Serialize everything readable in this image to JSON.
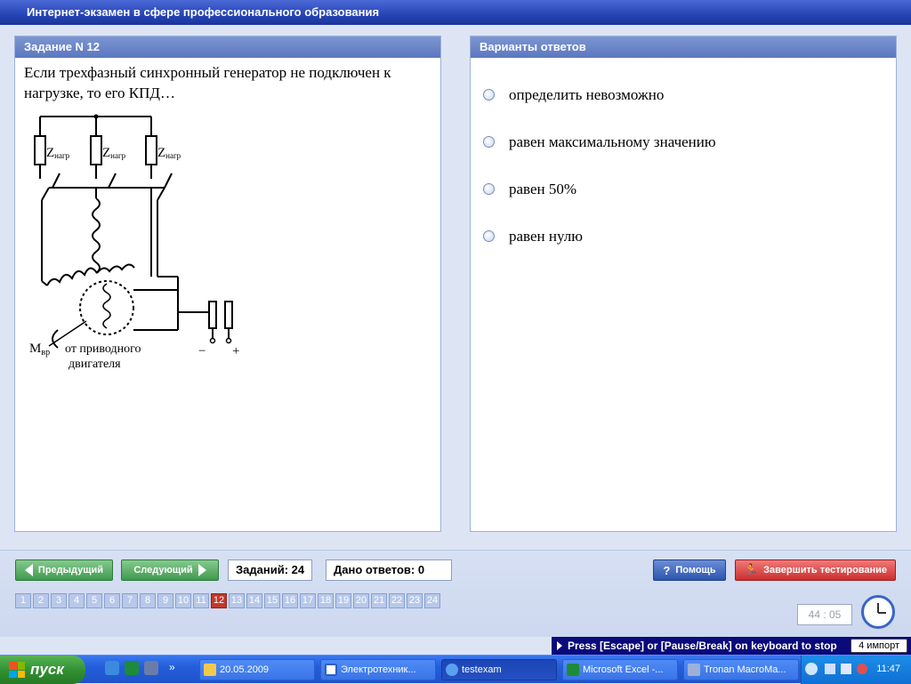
{
  "window": {
    "title": "Интернет-экзамен в сфере профессионального образования"
  },
  "task": {
    "header": "Задание N 12",
    "question": "Если трехфазный синхронный генератор не подключен к нагрузке, то его КПД…",
    "figure": {
      "load_label": "Z",
      "load_sub": "нагр",
      "moment_label": "M",
      "moment_sub": "вр",
      "caption_1": "от приводного",
      "caption_2": "двигателя",
      "minus": "−",
      "plus": "+"
    }
  },
  "answers": {
    "header": "Варианты ответов",
    "options": [
      {
        "label": "определить невозможно"
      },
      {
        "label": "равен максимальному значению"
      },
      {
        "label": "равен 50%"
      },
      {
        "label": "равен нулю"
      }
    ]
  },
  "nav": {
    "prev_label": "Предыдущий",
    "next_label": "Следующий",
    "total_label": "Заданий: 24",
    "answered_label": "Дано ответов: 0",
    "help_label": "Помощь",
    "finish_label": "Завершить тестирование",
    "question_numbers": [
      "1",
      "2",
      "3",
      "4",
      "5",
      "6",
      "7",
      "8",
      "9",
      "10",
      "11",
      "12",
      "13",
      "14",
      "15",
      "16",
      "17",
      "18",
      "19",
      "20",
      "21",
      "22",
      "23",
      "24"
    ],
    "current_question": "12",
    "timer": "44 : 05"
  },
  "hint": {
    "text": "Press [Escape] or [Pause/Break] on keyboard to stop",
    "badge": "4 импорт"
  },
  "taskbar": {
    "start_label": "пуск",
    "tasks": [
      {
        "label": "20.05.2009",
        "icon": "folder-icon",
        "color": "#f2c94c"
      },
      {
        "label": "Электротехник...",
        "icon": "word-icon",
        "color": "#2b5fc2"
      },
      {
        "label": "testexam",
        "icon": "ie-icon",
        "color": "#5aa0f0"
      },
      {
        "label": "Microsoft Excel -...",
        "icon": "excel-icon",
        "color": "#1e8b3a"
      },
      {
        "label": "Tronan MacroMa...",
        "icon": "play-icon",
        "color": "#9db0d8"
      }
    ],
    "time": "11:47"
  }
}
